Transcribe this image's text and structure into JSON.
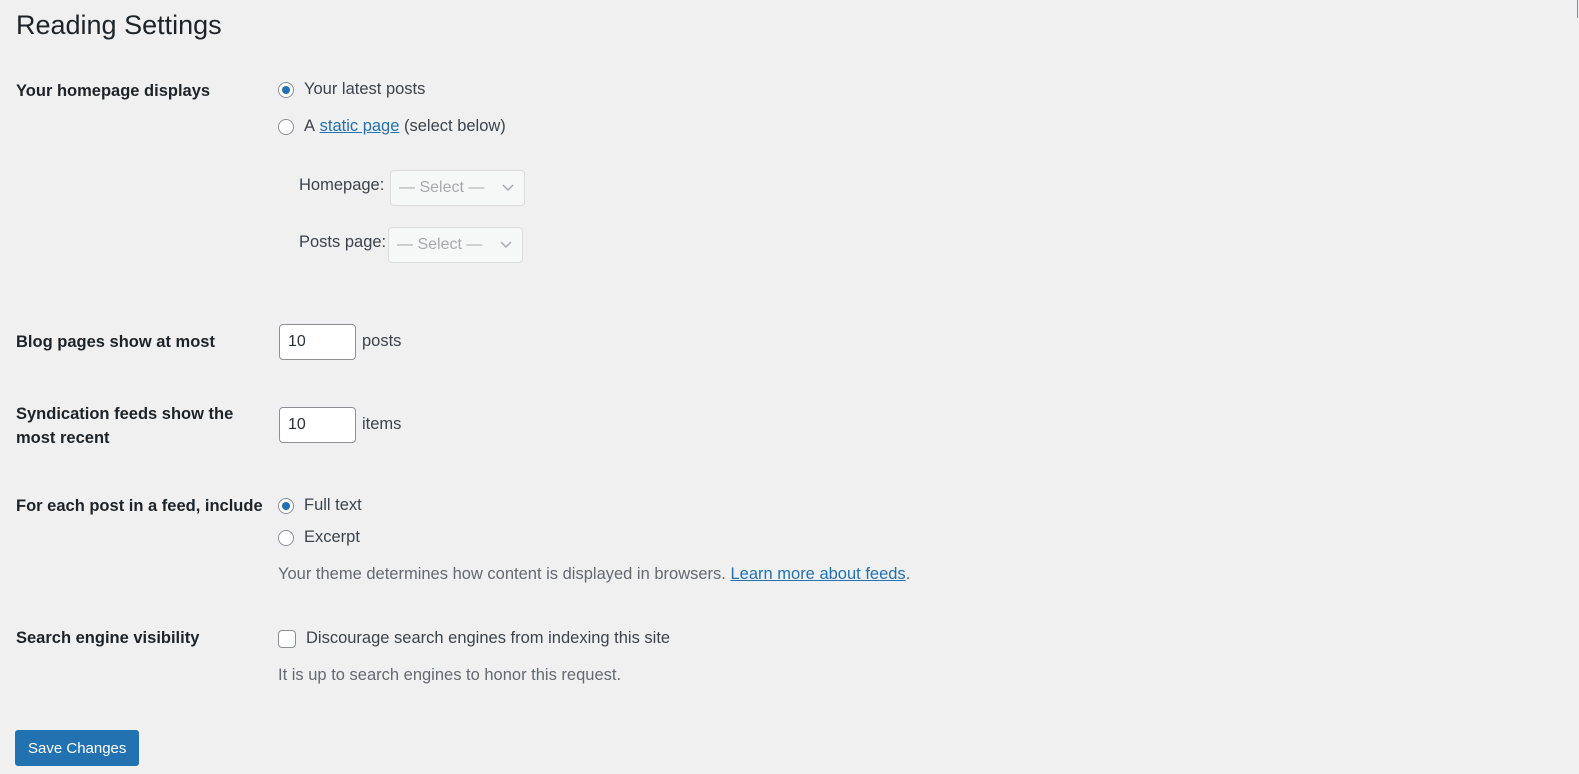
{
  "page": {
    "title": "Reading Settings"
  },
  "homepage_displays": {
    "label": "Your homepage displays",
    "options": [
      {
        "label": "Your latest posts",
        "checked": true
      },
      {
        "prefix": "A",
        "link": "static page",
        "suffix": "(select below)",
        "checked": false
      }
    ],
    "homepage_label": "Homepage:",
    "homepage_select": "— Select —",
    "posts_page_label": "Posts page:",
    "posts_page_select": "— Select —"
  },
  "blog_pages": {
    "label": "Blog pages show at most",
    "value": "10",
    "unit": "posts"
  },
  "syndication": {
    "label_line1": "Syndication feeds show the",
    "label_line2": "most recent",
    "value": "10",
    "unit": "items"
  },
  "feed_include": {
    "label": "For each post in a feed, include",
    "options": [
      {
        "label": "Full text",
        "checked": true
      },
      {
        "label": "Excerpt",
        "checked": false
      }
    ],
    "description": "Your theme determines how content is displayed in browsers.",
    "link": "Learn more about feeds",
    "link_suffix": "."
  },
  "search_visibility": {
    "label": "Search engine visibility",
    "checkbox_label": "Discourage search engines from indexing this site",
    "checked": false,
    "description": "It is up to search engines to honor this request."
  },
  "actions": {
    "save_label": "Save Changes"
  },
  "colors": {
    "accent": "#2271b1",
    "background": "#f0f0f1"
  }
}
